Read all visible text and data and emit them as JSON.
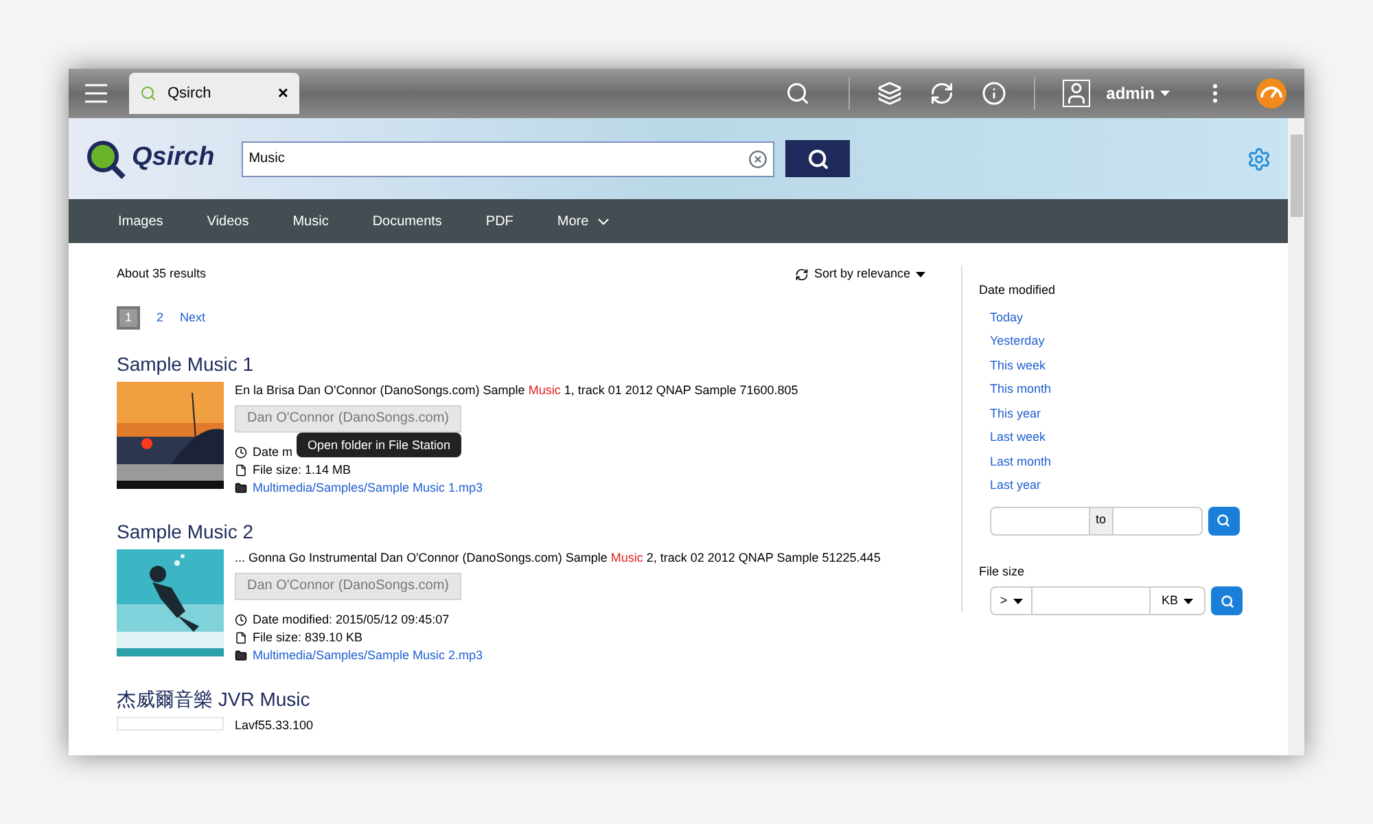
{
  "topbar": {
    "tab": {
      "title": "Qsirch",
      "close": "×"
    },
    "user": "admin"
  },
  "header": {
    "logo": "Qsirch",
    "search": {
      "value": "Music"
    }
  },
  "nav": [
    {
      "label": "Images",
      "kind": "link"
    },
    {
      "label": "Videos",
      "kind": "link"
    },
    {
      "label": "Music",
      "kind": "link"
    },
    {
      "label": "Documents",
      "kind": "link"
    },
    {
      "label": "PDF",
      "kind": "link"
    },
    {
      "label": "More",
      "kind": "menu"
    }
  ],
  "results_summary": "About 35 results",
  "sort": "Sort by relevance",
  "pagination": [
    {
      "label": "1",
      "selected": true
    },
    {
      "label": "2",
      "selected": false
    },
    {
      "label": "Next",
      "selected": false
    }
  ],
  "results": [
    {
      "title": "Sample Music 1",
      "snippet": "En la Brisa Dan O'Connor (DanoSongs.com) Sample **Music** 1, track 01 2012 QNAP Sample 71600.805",
      "artist": "Dan O'Connor (DanoSongs.com)",
      "date_modified": "Date m",
      "file_size": "File size: 1.14 MB",
      "path": "Multimedia/Samples/Sample Music 1.mp3",
      "tooltip": "Open folder in File Station"
    },
    {
      "title": "Sample Music 2",
      "snippet": "... Gonna Go Instrumental Dan O'Connor (DanoSongs.com) Sample **Music** 2, track 02 2012 QNAP Sample 51225.445",
      "artist": "Dan O'Connor (DanoSongs.com)",
      "date_modified": "Date modified: 2015/05/12 09:45:07",
      "file_size": "File size: 839.10 KB",
      "path": "Multimedia/Samples/Sample Music 2.mp3"
    },
    {
      "title": "杰威爾音樂 JVR Music",
      "snippet": "Lavf55.33.100",
      "thumbnail": {
        "kind": "blank"
      }
    }
  ],
  "filters": {
    "date_title": "Date modified",
    "dates": [
      "Today",
      "Yesterday",
      "This week",
      "This month",
      "This year",
      "Last week",
      "Last month",
      "Last year"
    ],
    "range_to": "to",
    "size_title": "File size",
    "size_op": ">",
    "size_unit": "KB"
  }
}
